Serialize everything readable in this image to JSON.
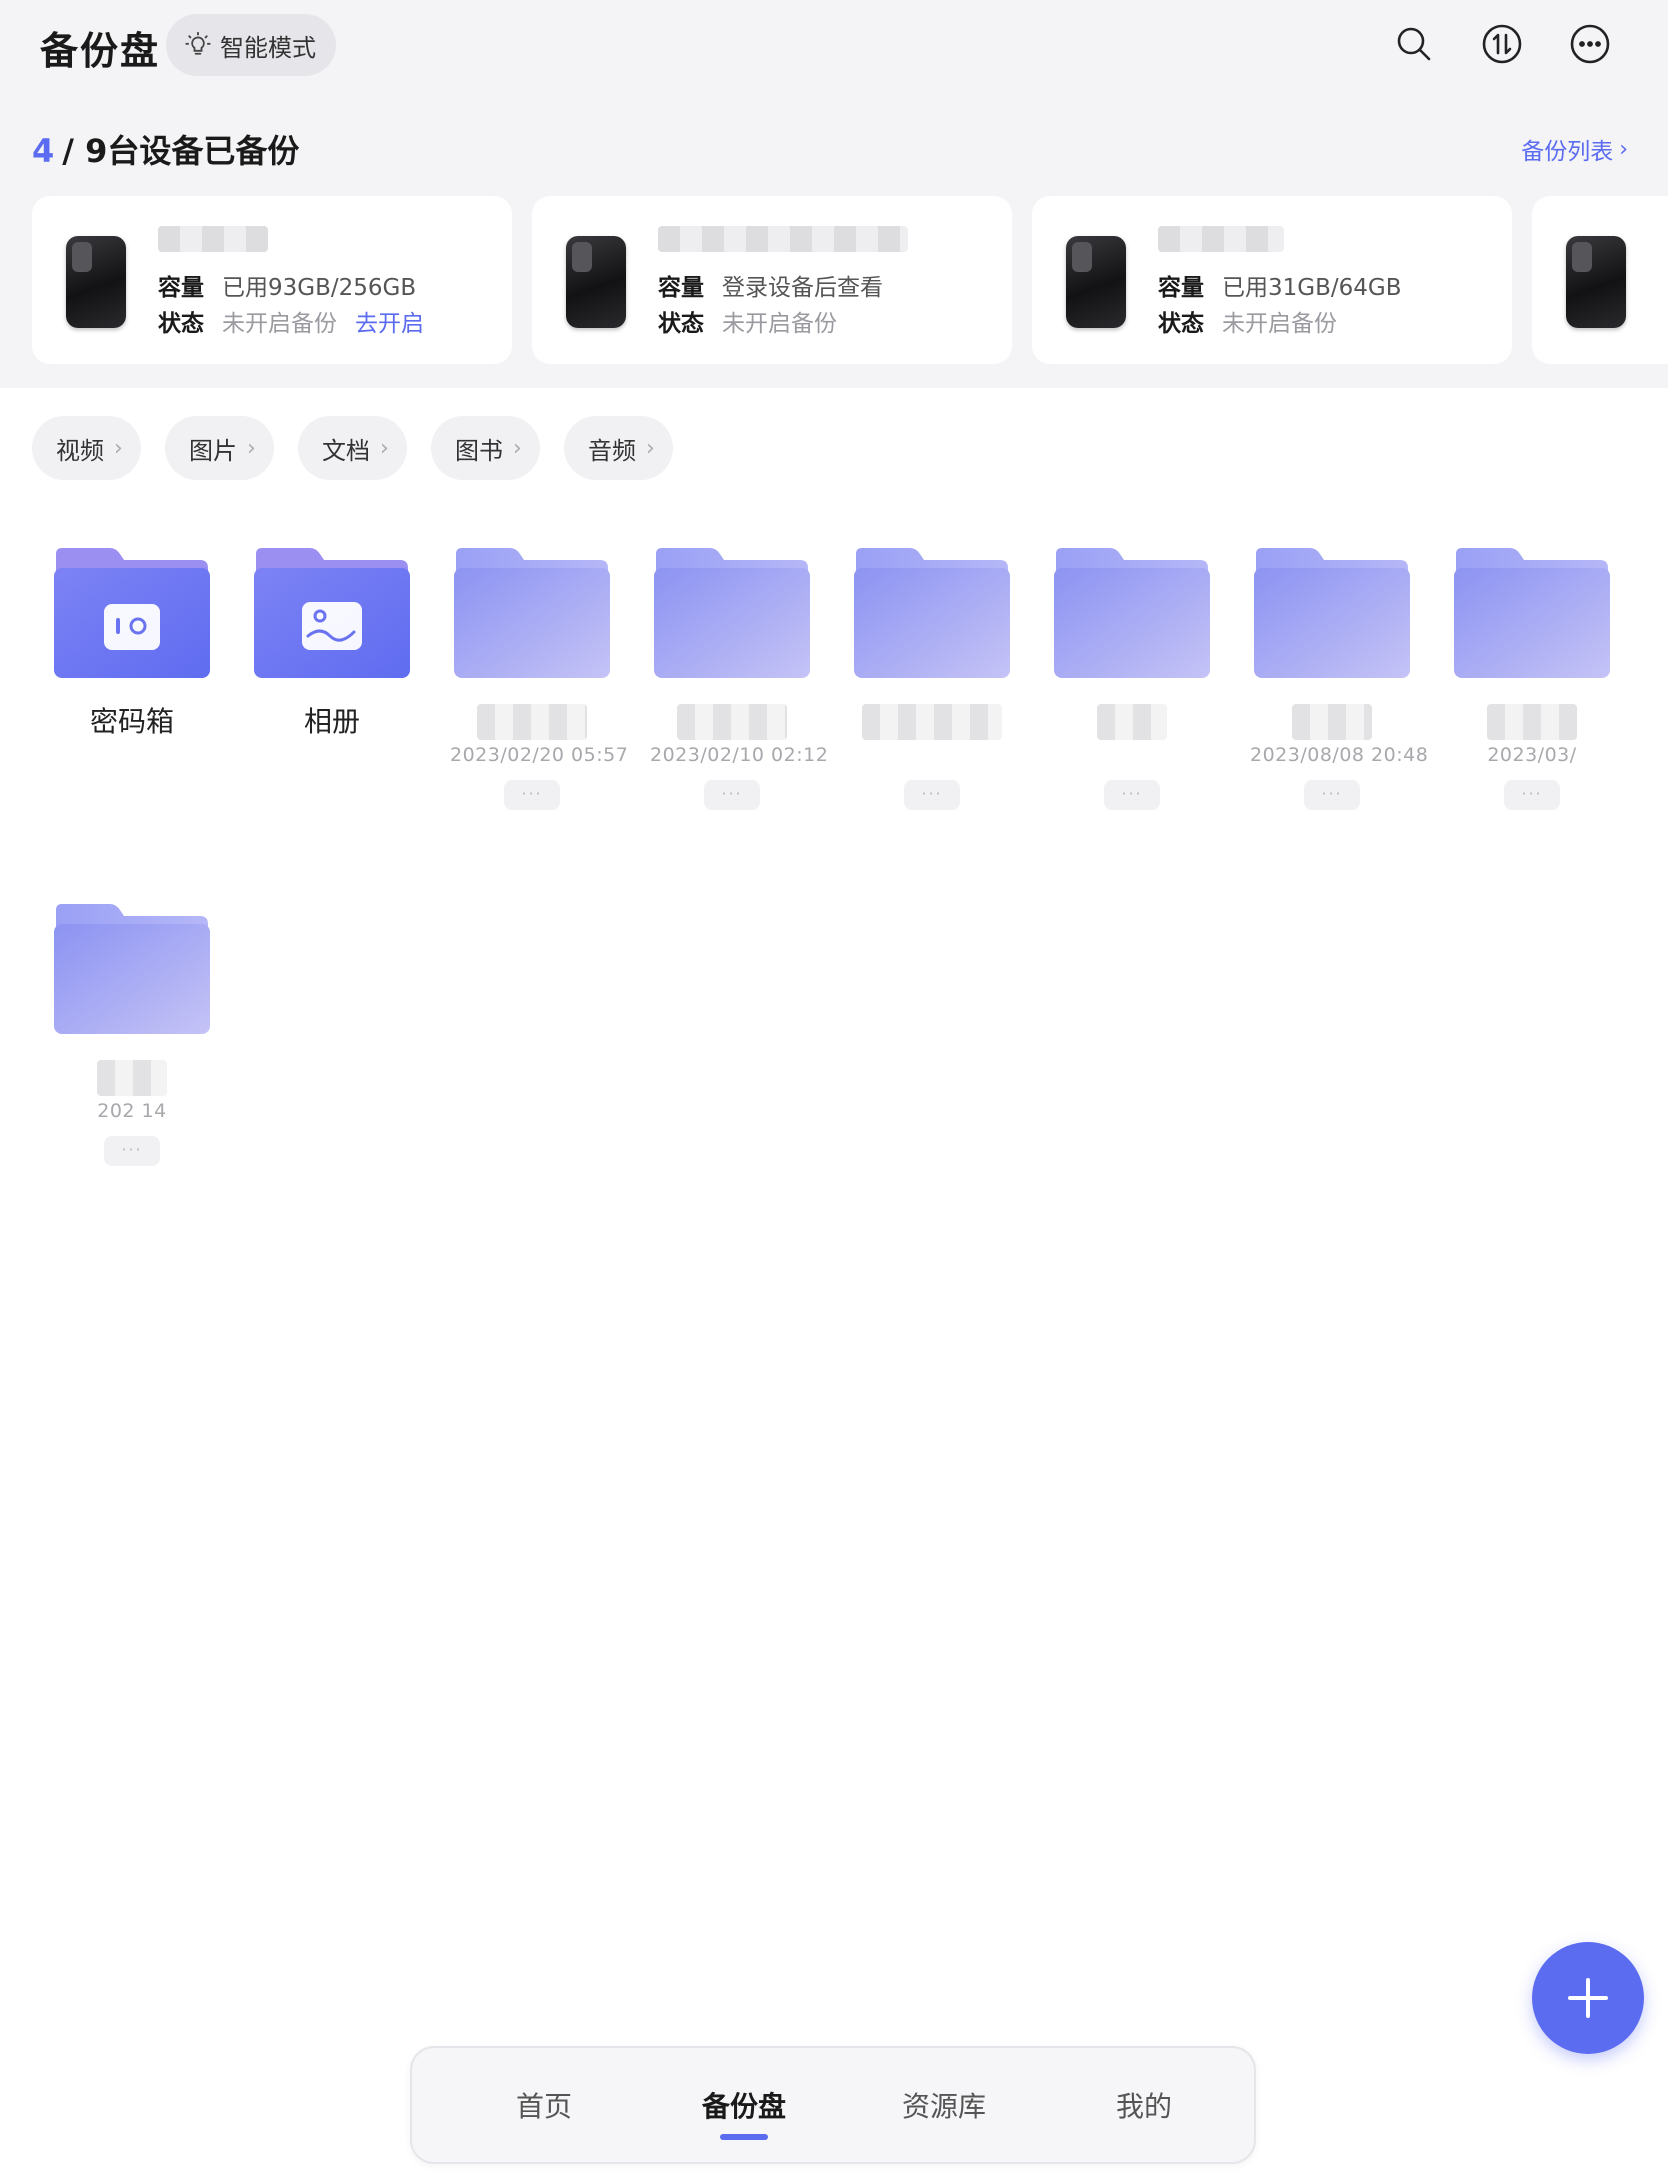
{
  "header": {
    "title": "备份盘",
    "smart_mode_label": "智能模式",
    "icons": [
      "search-icon",
      "transfer-icon",
      "more-icon"
    ]
  },
  "backup_summary": {
    "backed_up": "4",
    "rest": "/ 9台设备已备份",
    "list_link": "备份列表"
  },
  "devices": [
    {
      "capacity_label": "容量",
      "capacity_value": "已用93GB/256GB",
      "status_label": "状态",
      "status_value": "未开启备份",
      "action": "去开启",
      "icon": "android-phone-icon"
    },
    {
      "capacity_label": "容量",
      "capacity_value": "登录设备后查看",
      "status_label": "状态",
      "status_value": "未开启备份",
      "icon": "android-phone-icon"
    },
    {
      "capacity_label": "容量",
      "capacity_value": "已用31GB/64GB",
      "status_label": "状态",
      "status_value": "未开启备份",
      "icon": "apple-phone-icon"
    },
    {
      "icon": "android-phone-icon"
    }
  ],
  "categories": [
    "视频",
    "图片",
    "文档",
    "图书",
    "音频"
  ],
  "folders": [
    {
      "name": "密码箱",
      "type": "vault"
    },
    {
      "name": "相册",
      "type": "album"
    },
    {
      "date": "2023/02/20 05:57",
      "type": "generic"
    },
    {
      "date": "2023/02/10 02:12",
      "type": "generic"
    },
    {
      "date": "",
      "type": "generic"
    },
    {
      "date": "",
      "type": "generic"
    },
    {
      "date": "2023/08/08 20:48",
      "type": "generic"
    },
    {
      "date": "2023/03/",
      "type": "generic"
    },
    {
      "date": "202 14",
      "type": "generic"
    }
  ],
  "folder_more": "···",
  "fab_icon": "plus-icon",
  "bottom_nav": {
    "items": [
      "首页",
      "备份盘",
      "资源库",
      "我的"
    ],
    "active": "备份盘"
  },
  "colors": {
    "accent": "#5b6cf0",
    "folder": "#8c93f2"
  }
}
